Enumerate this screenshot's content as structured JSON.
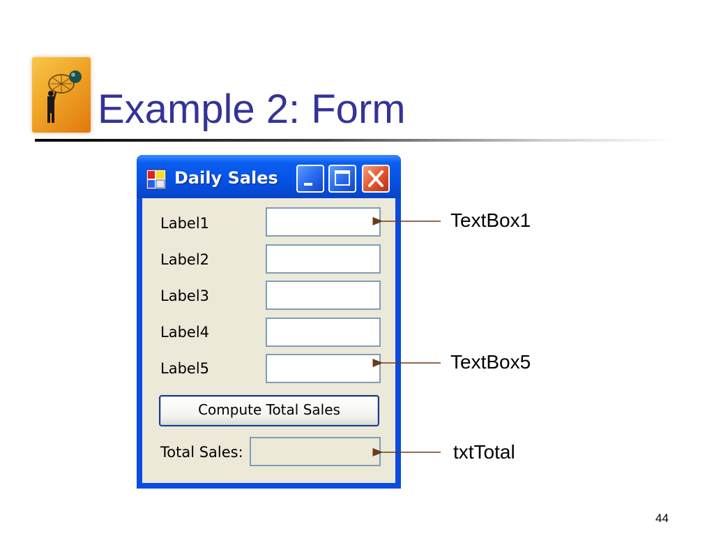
{
  "slide": {
    "title": "Example 2: Form",
    "page_number": "44"
  },
  "window": {
    "title": "Daily Sales",
    "icons": {
      "app": "form-app-icon",
      "minimize": "minimize-icon",
      "maximize": "maximize-icon",
      "close": "close-icon"
    }
  },
  "form": {
    "labels": [
      "Label1",
      "Label2",
      "Label3",
      "Label4",
      "Label5"
    ],
    "textboxes": [
      "",
      "",
      "",
      "",
      ""
    ],
    "compute_button": "Compute Total Sales",
    "total_label": "Total Sales:",
    "total_value": ""
  },
  "callouts": {
    "first": "TextBox1",
    "fifth": "TextBox5",
    "total": "txtTotal"
  },
  "colors": {
    "title": "#333399",
    "titlebar": "#0a5ef0",
    "close_button": "#e4582e",
    "form_bg": "#ece9d8",
    "arrow": "#6b3a1a"
  }
}
